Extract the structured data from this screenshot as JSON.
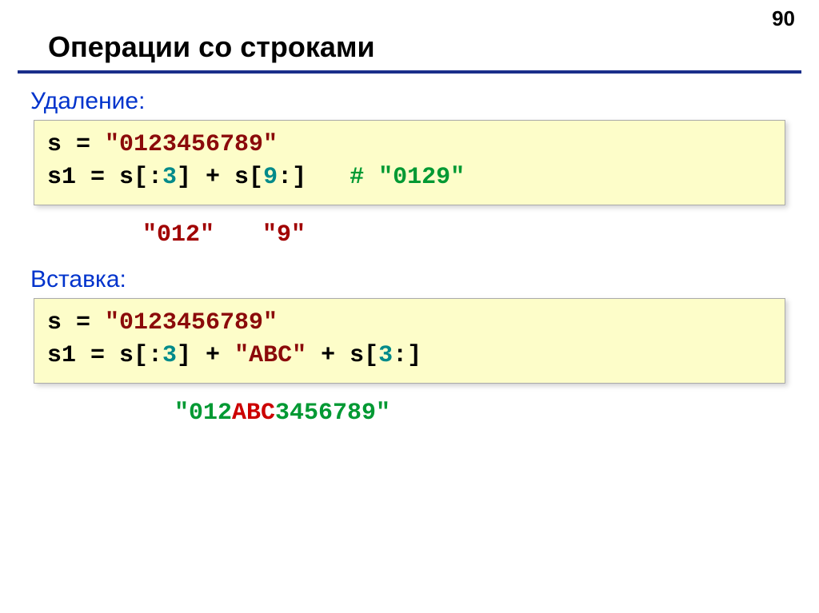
{
  "pageNumber": "90",
  "title": "Операции со строками",
  "deletion": {
    "label": "Удаление",
    "line1_pre": "s = ",
    "line1_str": "\"0123456789\"",
    "line2_a": "s1 = s[:",
    "line2_n1": "3",
    "line2_b": "] + s[",
    "line2_n2": "9",
    "line2_c": ":]   ",
    "line2_comment": "# \"0129\"",
    "ann1": "\"012\"",
    "ann2": "\"9\""
  },
  "insertion": {
    "label": "Вставка",
    "line1_pre": "s = ",
    "line1_str": "\"0123456789\"",
    "line2_a": "s1 = s[:",
    "line2_n1": "3",
    "line2_b": "] + ",
    "line2_str": "\"ABC\"",
    "line2_c": " + s[",
    "line2_n2": "3",
    "line2_d": ":]",
    "ann_pre": "\"012",
    "ann_mid": "ABC",
    "ann_post": "3456789\""
  }
}
